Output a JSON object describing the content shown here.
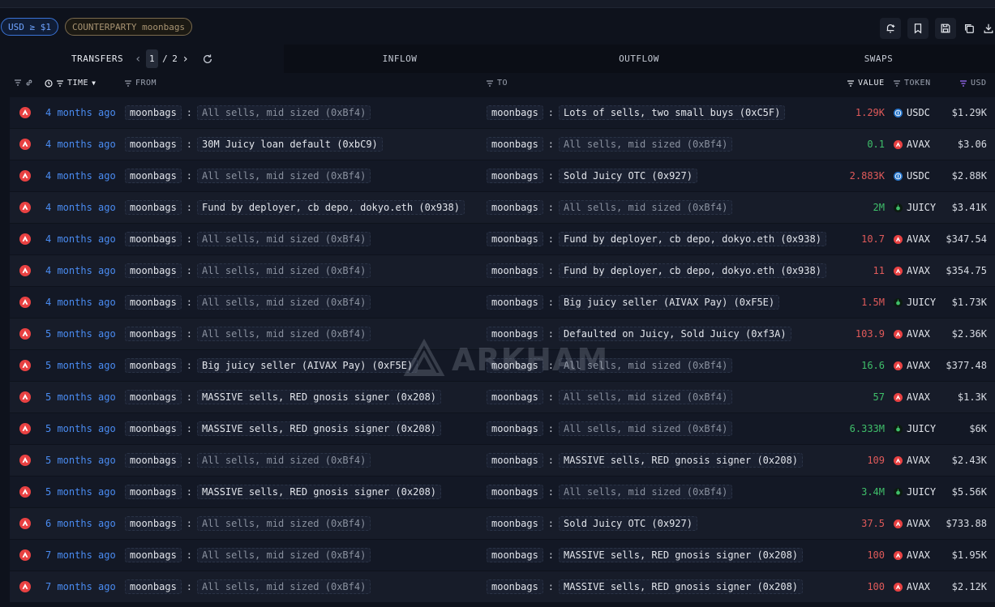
{
  "filters": {
    "usd": "USD ≥ $1",
    "counterparty": "COUNTERPARTY moonbags"
  },
  "toolbar_icons": [
    "bell-plus-icon",
    "bookmark-icon",
    "save-icon",
    "copy-icon",
    "download-icon"
  ],
  "tabs": {
    "transfers": "TRANSFERS",
    "page_current": "1",
    "page_sep": "/",
    "page_total": "2",
    "inflow": "INFLOW",
    "outflow": "OUTFLOW",
    "swaps": "SWAPS"
  },
  "columns": {
    "time": "TIME",
    "from": "FROM",
    "to": "TO",
    "value": "VALUE",
    "token": "TOKEN",
    "usd": "USD"
  },
  "watermark": "ARKHAM",
  "colors": {
    "accent": "#4a8cf2",
    "negative": "#e05a5a",
    "positive": "#3fbf6a",
    "avax": "#e84142",
    "usdc": "#2775ca"
  },
  "rows": [
    {
      "time": "4 months ago",
      "from_entity": "moonbags",
      "from_addr": "All sells, mid sized (0xBf4)",
      "to_entity": "moonbags",
      "to_addr": "Lots of sells, two small buys (0xC5F)",
      "value": "1.29K",
      "token": "USDC",
      "usd": "$1.29K"
    },
    {
      "time": "4 months ago",
      "from_entity": "moonbags",
      "from_addr": "30M Juicy loan default (0xbC9)",
      "to_entity": "moonbags",
      "to_addr": "All sells, mid sized (0xBf4)",
      "value": "0.1",
      "token": "AVAX",
      "usd": "$3.06"
    },
    {
      "time": "4 months ago",
      "from_entity": "moonbags",
      "from_addr": "All sells, mid sized (0xBf4)",
      "to_entity": "moonbags",
      "to_addr": "Sold Juicy OTC (0x927)",
      "value": "2.883K",
      "token": "USDC",
      "usd": "$2.88K"
    },
    {
      "time": "4 months ago",
      "from_entity": "moonbags",
      "from_addr": "Fund by deployer, cb depo, dokyo.eth (0x938)",
      "to_entity": "moonbags",
      "to_addr": "All sells, mid sized (0xBf4)",
      "value": "2M",
      "token": "JUICY",
      "usd": "$3.41K"
    },
    {
      "time": "4 months ago",
      "from_entity": "moonbags",
      "from_addr": "All sells, mid sized (0xBf4)",
      "to_entity": "moonbags",
      "to_addr": "Fund by deployer, cb depo, dokyo.eth (0x938)",
      "value": "10.7",
      "token": "AVAX",
      "usd": "$347.54"
    },
    {
      "time": "4 months ago",
      "from_entity": "moonbags",
      "from_addr": "All sells, mid sized (0xBf4)",
      "to_entity": "moonbags",
      "to_addr": "Fund by deployer, cb depo, dokyo.eth (0x938)",
      "value": "11",
      "token": "AVAX",
      "usd": "$354.75"
    },
    {
      "time": "4 months ago",
      "from_entity": "moonbags",
      "from_addr": "All sells, mid sized (0xBf4)",
      "to_entity": "moonbags",
      "to_addr": "Big juicy seller (AIVAX Pay) (0xF5E)",
      "value": "1.5M",
      "token": "JUICY",
      "usd": "$1.73K"
    },
    {
      "time": "5 months ago",
      "from_entity": "moonbags",
      "from_addr": "All sells, mid sized (0xBf4)",
      "to_entity": "moonbags",
      "to_addr": "Defaulted on Juicy, Sold Juicy (0xf3A)",
      "value": "103.9",
      "token": "AVAX",
      "usd": "$2.36K"
    },
    {
      "time": "5 months ago",
      "from_entity": "moonbags",
      "from_addr": "Big juicy seller (AIVAX Pay) (0xF5E)",
      "to_entity": "moonbags",
      "to_addr": "All sells, mid sized (0xBf4)",
      "value": "16.6",
      "token": "AVAX",
      "usd": "$377.48"
    },
    {
      "time": "5 months ago",
      "from_entity": "moonbags",
      "from_addr": "MASSIVE sells, RED gnosis signer (0x208)",
      "to_entity": "moonbags",
      "to_addr": "All sells, mid sized (0xBf4)",
      "value": "57",
      "token": "AVAX",
      "usd": "$1.3K"
    },
    {
      "time": "5 months ago",
      "from_entity": "moonbags",
      "from_addr": "MASSIVE sells, RED gnosis signer (0x208)",
      "to_entity": "moonbags",
      "to_addr": "All sells, mid sized (0xBf4)",
      "value": "6.333M",
      "token": "JUICY",
      "usd": "$6K"
    },
    {
      "time": "5 months ago",
      "from_entity": "moonbags",
      "from_addr": "All sells, mid sized (0xBf4)",
      "to_entity": "moonbags",
      "to_addr": "MASSIVE sells, RED gnosis signer (0x208)",
      "value": "109",
      "token": "AVAX",
      "usd": "$2.43K"
    },
    {
      "time": "5 months ago",
      "from_entity": "moonbags",
      "from_addr": "MASSIVE sells, RED gnosis signer (0x208)",
      "to_entity": "moonbags",
      "to_addr": "All sells, mid sized (0xBf4)",
      "value": "3.4M",
      "token": "JUICY",
      "usd": "$5.56K"
    },
    {
      "time": "6 months ago",
      "from_entity": "moonbags",
      "from_addr": "All sells, mid sized (0xBf4)",
      "to_entity": "moonbags",
      "to_addr": "Sold Juicy OTC (0x927)",
      "value": "37.5",
      "token": "AVAX",
      "usd": "$733.88"
    },
    {
      "time": "7 months ago",
      "from_entity": "moonbags",
      "from_addr": "All sells, mid sized (0xBf4)",
      "to_entity": "moonbags",
      "to_addr": "MASSIVE sells, RED gnosis signer (0x208)",
      "value": "100",
      "token": "AVAX",
      "usd": "$1.95K"
    },
    {
      "time": "7 months ago",
      "from_entity": "moonbags",
      "from_addr": "All sells, mid sized (0xBf4)",
      "to_entity": "moonbags",
      "to_addr": "MASSIVE sells, RED gnosis signer (0x208)",
      "value": "100",
      "token": "AVAX",
      "usd": "$2.12K"
    }
  ]
}
